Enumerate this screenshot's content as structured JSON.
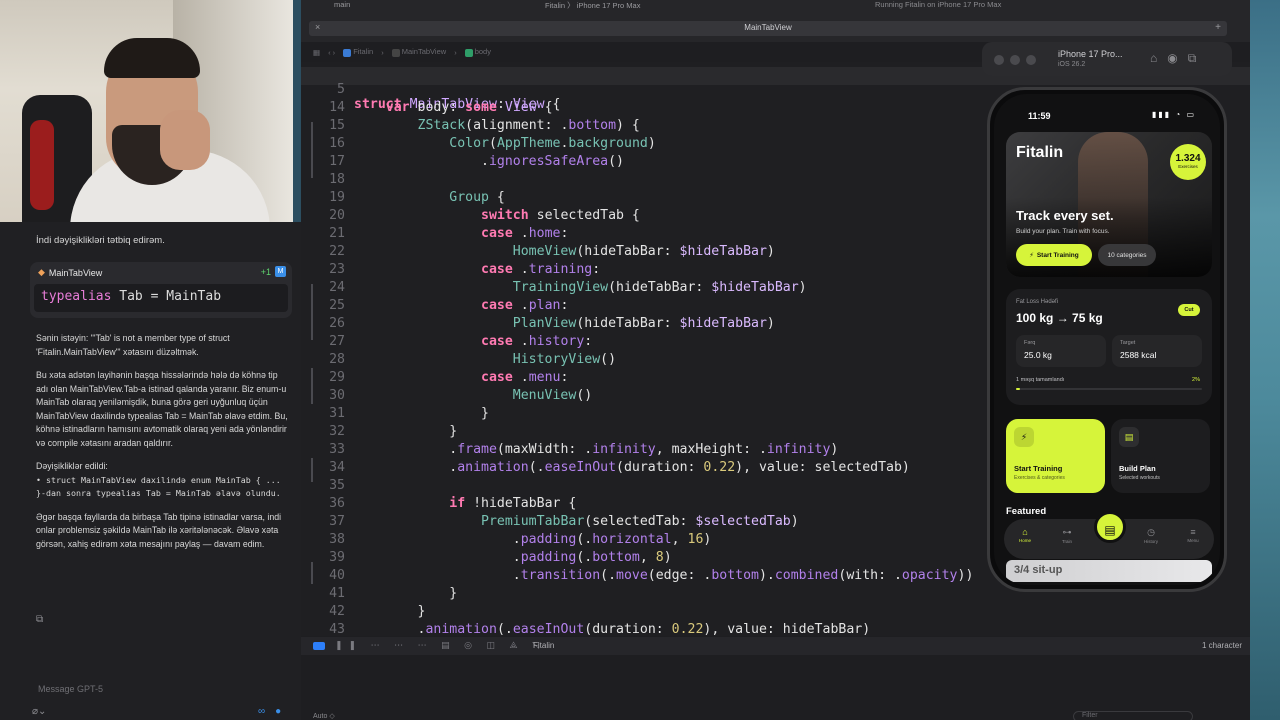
{
  "window": {
    "scheme": "main",
    "run_destination": "Fitalin  〉  iPhone 17 Pro Max",
    "run_status": "Running Fitalin on iPhone 17 Pro Max",
    "tab_title": "MainTabView"
  },
  "breadcrumb": [
    "Fitalin",
    "MainTabView",
    "body"
  ],
  "chat": {
    "intro": "İndi dəyişiklikləri tətbiq edirəm.",
    "file_name": "MainTabView",
    "diff_count": "+1",
    "diff_badge": "M",
    "code_keyword": "typealias",
    "code_rest": " Tab = MainTab",
    "p1": "Sənin istəyin: \"'Tab' is not a member type of struct 'Fitalin.MainTabView'\" xətasını düzəltmək.",
    "p2": "Bu xəta adətən layihənin başqa hissələrində hələ də köhnə tip adı olan MainTabView.Tab-a istinad qalanda yaranır. Biz enum-u MainTab olaraq yeniləmişdik, buna görə geri uyğunluq üçün MainTabView daxilində typealias Tab = MainTab əlavə etdim. Bu, köhnə istinadların hamısını avtomatik olaraq yeni ada yönləndirir və compile xətasını aradan qaldırır.",
    "p3_title": "Dəyişikliklər edildi:",
    "p3_item": "• struct MainTabView daxilində enum MainTab { ... }-dan sonra typealias Tab = MainTab əlavə olundu.",
    "p4": "Əgər başqa fayllarda da birbaşa Tab tipinə istinadlar varsa, indi onlar problemsiz şəkildə MainTab ilə xəritələnəcək. Əlavə xəta görsən, xahiş edirəm xəta mesajını paylaş — davam edim.",
    "input_placeholder": "Message GPT-5"
  },
  "code": {
    "sticky_line": {
      "num": "5",
      "text": "struct MainTabView: View {"
    },
    "lines": [
      {
        "num": "14"
      },
      {
        "num": "15"
      },
      {
        "num": "16"
      },
      {
        "num": "17"
      },
      {
        "num": "18"
      },
      {
        "num": "19"
      },
      {
        "num": "20"
      },
      {
        "num": "21"
      },
      {
        "num": "22"
      },
      {
        "num": "23"
      },
      {
        "num": "24"
      },
      {
        "num": "25"
      },
      {
        "num": "26"
      },
      {
        "num": "27"
      },
      {
        "num": "28"
      },
      {
        "num": "29"
      },
      {
        "num": "30"
      },
      {
        "num": "31"
      },
      {
        "num": "32"
      },
      {
        "num": "33"
      },
      {
        "num": "34"
      },
      {
        "num": "35"
      },
      {
        "num": "36"
      },
      {
        "num": "37"
      },
      {
        "num": "38"
      },
      {
        "num": "39"
      },
      {
        "num": "40"
      },
      {
        "num": "41"
      },
      {
        "num": "42"
      },
      {
        "num": "43"
      }
    ]
  },
  "debug": {
    "target": "Fitalin",
    "selection": "1 character",
    "auto_label": "Auto ◇",
    "filter_placeholder": "Filter"
  },
  "simulator": {
    "device": "iPhone 17 Pro...",
    "os": "iOS 26.2",
    "time": "11:59",
    "app_name": "Fitalin",
    "exercise_count": "1.324",
    "exercise_label": "Exercises",
    "hero_title": "Track every set.",
    "hero_sub": "Build your plan. Train with focus.",
    "start_button": "Start Training",
    "categories_pill": "10 categories",
    "goal_label": "Fat Loss Hədəfi",
    "goal_value": "100 kg → 75 kg",
    "goal_badge": "Cut",
    "stat1_label": "Fərq",
    "stat1_value": "25.0 kg",
    "stat2_label": "Target",
    "stat2_value": "2588 kcal",
    "progress_label": "1 məşq tamamlandı",
    "progress_pct": "2%",
    "progress_value": 0.02,
    "card1_title": "Start Training",
    "card1_sub": "Exercises & categories",
    "card2_title": "Build Plan",
    "card2_sub": "Selected workouts",
    "featured": "Featured",
    "tabs": [
      "Home",
      "Train",
      "",
      "History",
      "Menu"
    ],
    "peek_text": "3/4 sit-up"
  },
  "colors": {
    "accent": "#d6f43a",
    "editor_bg": "#1f1f22",
    "keyword": "#ff7ab2"
  }
}
